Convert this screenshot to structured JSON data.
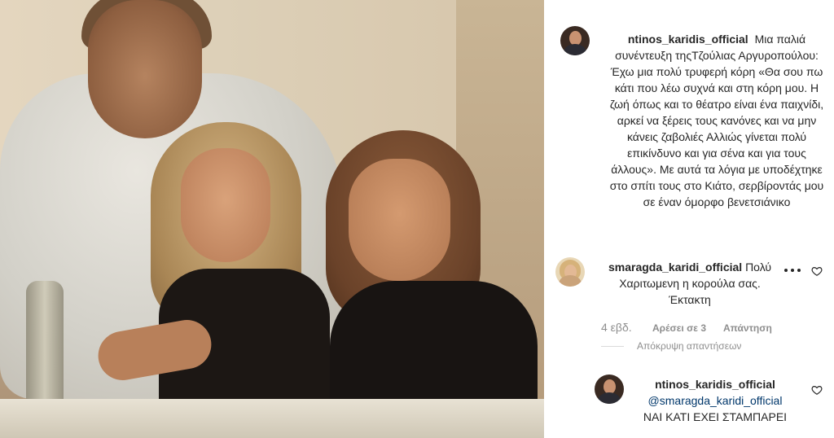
{
  "post": {
    "photo_alt": "",
    "caption": {
      "username": "ntinos_karidis_official",
      "text": "Μια παλιά συνέντευξη τηςΤζούλιας Αργυροπούλου: Έχω μια πολύ τρυφερή κόρη «Θα σου πω κάτι που λέω συχνά και στη κόρη μου. Η ζωή όπως και το θέατρο είναι ένα παιχνίδι, αρκεί να ξέρεις τους κανόνες και να μην κάνεις ζαβολιές Αλλιώς γίνεται πολύ επικίνδυνο και για σένα και για τους άλλους». Με αυτά τα λόγια με υποδέχτηκε στο σπίτι τους στο Κιάτο, σερβίροντάς μου σε έναν όμορφο βενετσιάνικο"
    }
  },
  "comments": [
    {
      "username": "smaragda_karidi_official",
      "text": "Πολύ Χαριτωμενη η κορούλα σας. Έκτακτη",
      "time": "4 εβδ.",
      "likes": "Αρέσει σε 3",
      "reply": "Απάντηση"
    }
  ],
  "hide_replies": "Απόκρυψη απαντήσεων",
  "replies": [
    {
      "username": "ntinos_karidis_official",
      "mention": "@smaragda_karidi_official",
      "text": "ΝΑΙ ΚΑΤΙ ΕΧΕΙ ΣΤΑΜΠΑΡΕΙ"
    }
  ],
  "icons": {
    "more": "more-options-icon",
    "like": "heart-icon"
  },
  "colors": {
    "text": "#262626",
    "muted": "#8e8e8e",
    "mention": "#00376b"
  }
}
